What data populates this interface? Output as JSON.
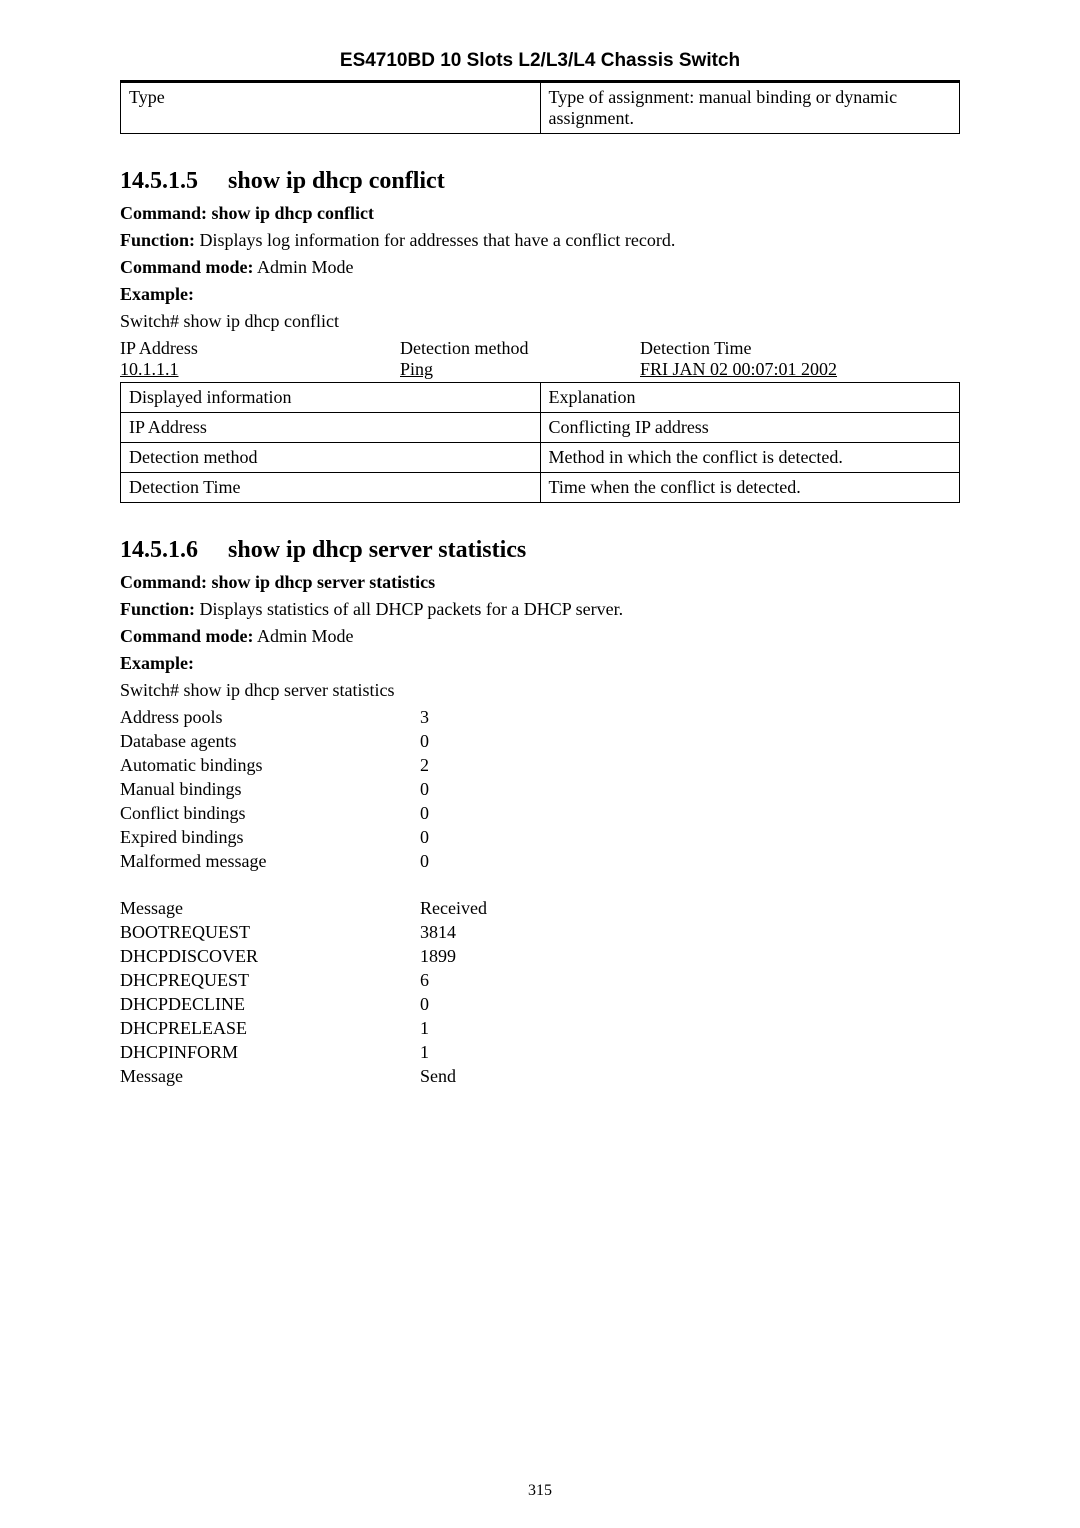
{
  "header": {
    "title": "ES4710BD 10 Slots L2/L3/L4 Chassis Switch"
  },
  "topTable": {
    "left": "Type",
    "right": "Type of assignment: manual binding or dynamic assignment."
  },
  "section1": {
    "number": "14.5.1.5",
    "title": "show ip dhcp conflict",
    "commandLabel": "Command: show ip dhcp conflict",
    "functionLabel": "Function:",
    "functionText": " Displays log information for addresses that have a conflict record.",
    "modeLabel": "Command mode:",
    "modeText": " Admin Mode",
    "exampleLabel": "Example:",
    "exampleLine": "Switch# show ip dhcp conflict",
    "row1": {
      "a": "IP Address",
      "b": "Detection method",
      "c": "Detection Time"
    },
    "row2": {
      "a": "10.1.1.1",
      "b": "Ping",
      "c": "FRI JAN 02 00:07:01 2002"
    },
    "table": [
      {
        "l": "Displayed information",
        "r": "Explanation"
      },
      {
        "l": "IP Address",
        "r": "Conflicting IP address"
      },
      {
        "l": "Detection method",
        "r": "Method in which the conflict is detected."
      },
      {
        "l": "Detection Time",
        "r": "Time when the conflict is detected."
      }
    ]
  },
  "section2": {
    "number": "14.5.1.6",
    "title": "show ip dhcp server statistics",
    "commandLabel": "Command: show ip dhcp server statistics",
    "functionLabel": "Function:",
    "functionText": " Displays statistics of all DHCP packets for a DHCP server.",
    "modeLabel": "Command mode:",
    "modeText": " Admin Mode",
    "exampleLabel": "Example:",
    "exampleLine": "Switch# show ip dhcp server statistics",
    "stats": [
      {
        "label": "Address pools",
        "value": "3"
      },
      {
        "label": "Database agents",
        "value": "0"
      },
      {
        "label": "Automatic bindings",
        "value": "2"
      },
      {
        "label": "Manual bindings",
        "value": "0"
      },
      {
        "label": "Conflict bindings",
        "value": "0"
      },
      {
        "label": "Expired bindings",
        "value": "0"
      },
      {
        "label": "Malformed message",
        "value": "0"
      }
    ],
    "stats2": [
      {
        "label": "Message",
        "value": "Received"
      },
      {
        "label": "BOOTREQUEST",
        "value": "3814"
      },
      {
        "label": "DHCPDISCOVER",
        "value": "1899"
      },
      {
        "label": "DHCPREQUEST",
        "value": "6"
      },
      {
        "label": "DHCPDECLINE",
        "value": "0"
      },
      {
        "label": "DHCPRELEASE",
        "value": "1"
      },
      {
        "label": "DHCPINFORM",
        "value": "1"
      },
      {
        "label": "Message",
        "value": "Send"
      }
    ]
  },
  "pageNumber": "315"
}
